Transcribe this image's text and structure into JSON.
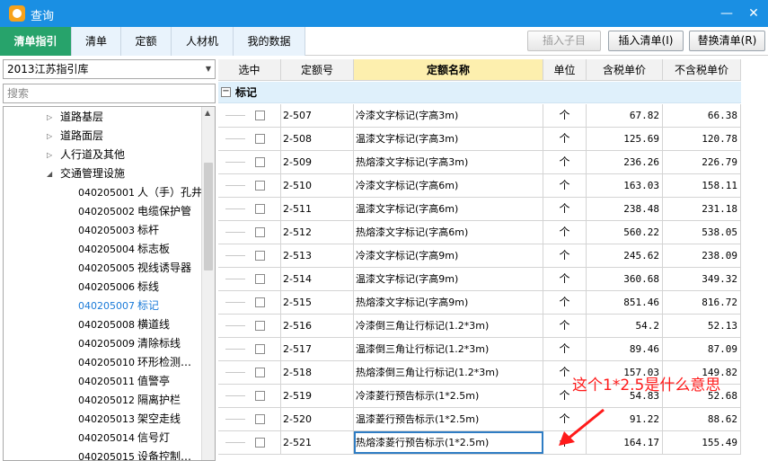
{
  "window": {
    "title": "查询",
    "minimize_glyph": "—",
    "close_glyph": "✕"
  },
  "tabs": [
    {
      "label": "清单指引",
      "active": true
    },
    {
      "label": "清单",
      "active": false
    },
    {
      "label": "定额",
      "active": false
    },
    {
      "label": "人材机",
      "active": false
    },
    {
      "label": "我的数据",
      "active": false
    }
  ],
  "toolbar": {
    "insert_child_label": "插入子目",
    "insert_list_label": "插入清单(I)",
    "replace_list_label": "替换清单(R)"
  },
  "library_select": {
    "value": "2013江苏指引库"
  },
  "search": {
    "placeholder": "搜索"
  },
  "tree": {
    "items": [
      {
        "label": "道路基层",
        "code": "",
        "arrow": "▷"
      },
      {
        "label": "道路面层",
        "code": "",
        "arrow": "▷"
      },
      {
        "label": "人行道及其他",
        "code": "",
        "arrow": "▷"
      },
      {
        "label": "交通管理设施",
        "code": "",
        "arrow": "◢"
      },
      {
        "code": "040205001",
        "label": "人（手）孔井"
      },
      {
        "code": "040205002",
        "label": "电缆保护管"
      },
      {
        "code": "040205003",
        "label": "标杆"
      },
      {
        "code": "040205004",
        "label": "标志板"
      },
      {
        "code": "040205005",
        "label": "视线诱导器"
      },
      {
        "code": "040205006",
        "label": "标线"
      },
      {
        "code": "040205007",
        "label": "标记",
        "selected": true
      },
      {
        "code": "040205008",
        "label": "横道线"
      },
      {
        "code": "040205009",
        "label": "清除标线"
      },
      {
        "code": "040205010",
        "label": "环形检测…"
      },
      {
        "code": "040205011",
        "label": "值警亭"
      },
      {
        "code": "040205012",
        "label": "隔离护栏"
      },
      {
        "code": "040205013",
        "label": "架空走线"
      },
      {
        "code": "040205014",
        "label": "信号灯"
      },
      {
        "code": "040205015",
        "label": "设备控制…"
      }
    ]
  },
  "table": {
    "columns": [
      "选中",
      "定额号",
      "定额名称",
      "单位",
      "含税单价",
      "不含税单价"
    ],
    "group": {
      "label": "标记",
      "toggle": "−"
    },
    "rows": [
      {
        "code": "2-507",
        "name": "冷漆文字标记(字高3m)",
        "unit": "个",
        "price_tax": "67.82",
        "price_notax": "66.38"
      },
      {
        "code": "2-508",
        "name": "温漆文字标记(字高3m)",
        "unit": "个",
        "price_tax": "125.69",
        "price_notax": "120.78"
      },
      {
        "code": "2-509",
        "name": "热熔漆文字标记(字高3m)",
        "unit": "个",
        "price_tax": "236.26",
        "price_notax": "226.79"
      },
      {
        "code": "2-510",
        "name": "冷漆文字标记(字高6m)",
        "unit": "个",
        "price_tax": "163.03",
        "price_notax": "158.11"
      },
      {
        "code": "2-511",
        "name": "温漆文字标记(字高6m)",
        "unit": "个",
        "price_tax": "238.48",
        "price_notax": "231.18"
      },
      {
        "code": "2-512",
        "name": "热熔漆文字标记(字高6m)",
        "unit": "个",
        "price_tax": "560.22",
        "price_notax": "538.05"
      },
      {
        "code": "2-513",
        "name": "冷漆文字标记(字高9m)",
        "unit": "个",
        "price_tax": "245.62",
        "price_notax": "238.09"
      },
      {
        "code": "2-514",
        "name": "温漆文字标记(字高9m)",
        "unit": "个",
        "price_tax": "360.68",
        "price_notax": "349.32"
      },
      {
        "code": "2-515",
        "name": "热熔漆文字标记(字高9m)",
        "unit": "个",
        "price_tax": "851.46",
        "price_notax": "816.72"
      },
      {
        "code": "2-516",
        "name": "冷漆倒三角让行标记(1.2*3m)",
        "unit": "个",
        "price_tax": "54.2",
        "price_notax": "52.13"
      },
      {
        "code": "2-517",
        "name": "温漆倒三角让行标记(1.2*3m)",
        "unit": "个",
        "price_tax": "89.46",
        "price_notax": "87.09"
      },
      {
        "code": "2-518",
        "name": "热熔漆倒三角让行标记(1.2*3m)",
        "unit": "个",
        "price_tax": "157.03",
        "price_notax": "149.82"
      },
      {
        "code": "2-519",
        "name": "冷漆菱行预告标示(1*2.5m)",
        "unit": "个",
        "price_tax": "54.83",
        "price_notax": "52.68"
      },
      {
        "code": "2-520",
        "name": "温漆菱行预告标示(1*2.5m)",
        "unit": "个",
        "price_tax": "91.22",
        "price_notax": "88.62"
      },
      {
        "code": "2-521",
        "name": "热熔漆菱行预告标示(1*2.5m)",
        "unit": "个",
        "price_tax": "164.17",
        "price_notax": "155.49",
        "selected": true
      }
    ]
  },
  "annotation": {
    "text": "这个1*2.5是什么意思",
    "color": "#ff1a1a"
  },
  "colors": {
    "title_bar": "#1a8fe3",
    "active_tab": "#27a36b",
    "header_highlight": "#fdefae",
    "group_row": "#dff0fb"
  }
}
